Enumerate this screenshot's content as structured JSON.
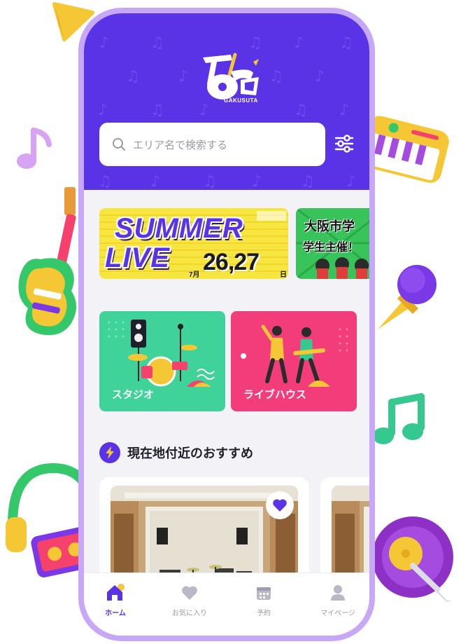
{
  "app": {
    "logo_text": "ガクスタ",
    "logo_sub": "GAKUSUTA"
  },
  "search": {
    "placeholder": "エリア名で検索する",
    "search_icon": "search-icon",
    "filter_icon": "sliders-icon"
  },
  "banners": [
    {
      "line1": "SUMMER",
      "line2": "LIVE",
      "month": "7月",
      "dates": "26,27",
      "day_suffix": "日"
    },
    {
      "line1": "大阪市学",
      "line2": "学生主催！"
    }
  ],
  "categories": [
    {
      "label": "スタジオ",
      "color": "#3fd39a"
    },
    {
      "label": "ライブハウス",
      "color": "#f23d7a"
    }
  ],
  "section": {
    "title": "現在地付近のおすすめ",
    "icon": "bolt-icon"
  },
  "recommendations": [
    {
      "favorite": true
    },
    {
      "favorite": false
    }
  ],
  "tabs": [
    {
      "label": "ホーム",
      "icon": "home-icon",
      "active": true
    },
    {
      "label": "お気に入り",
      "icon": "heart-icon",
      "active": false
    },
    {
      "label": "予約",
      "icon": "calendar-icon",
      "active": false
    },
    {
      "label": "マイページ",
      "icon": "user-icon",
      "active": false
    }
  ],
  "colors": {
    "brand": "#5a33e6",
    "phone_frame": "#c7a7f8",
    "studio": "#3fd39a",
    "livehouse": "#f23d7a"
  }
}
